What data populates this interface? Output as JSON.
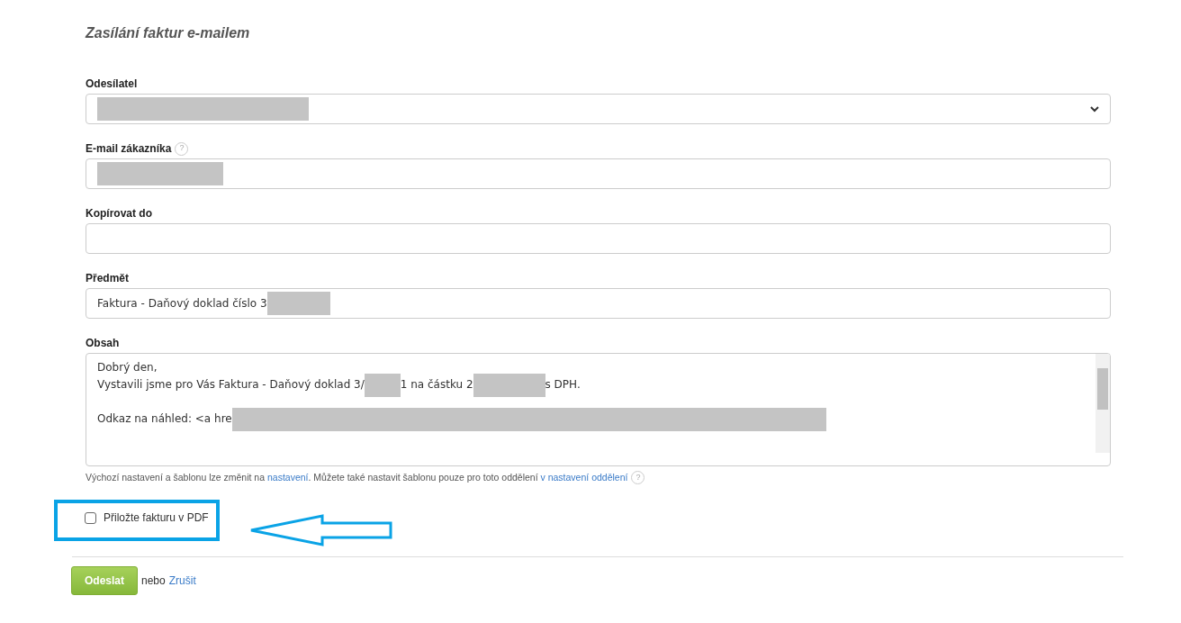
{
  "title": "Zasílání faktur e-mailem",
  "fields": [
    {
      "kind": "select",
      "label": "Odesílatel",
      "segments": [
        {
          "kind": "redacted"
        }
      ]
    },
    {
      "kind": "input",
      "label": "E-mail zákazníka",
      "help_icon": "?",
      "segments": [
        {
          "kind": "redacted"
        }
      ]
    },
    {
      "kind": "input",
      "label": "Kopírovat do"
    },
    {
      "kind": "input",
      "label": "Předmět",
      "segments": [
        {
          "kind": "text",
          "text": "Faktura - Daňový doklad číslo 3"
        },
        {
          "kind": "redacted"
        }
      ]
    },
    {
      "kind": "textarea",
      "label": "Obsah",
      "paragraphs": [
        [
          [
            {
              "kind": "text",
              "text": "Dobrý den,"
            }
          ],
          [
            {
              "kind": "text",
              "text": "Vystavili jsme pro Vás Faktura - Daňový doklad 3/"
            },
            {
              "kind": "redacted"
            },
            {
              "kind": "text",
              "text": "1 na částku 2"
            },
            {
              "kind": "redacted"
            },
            {
              "kind": "text",
              "text": "s DPH."
            }
          ]
        ],
        [
          [
            {
              "kind": "text",
              "text": "Odkaz na náhled: <a hre"
            },
            {
              "kind": "redacted"
            }
          ]
        ]
      ]
    }
  ],
  "note": {
    "text": "Výchozí nastavení a šablonu lze změnit na",
    "link1": "nastavení",
    "text2": ". Můžete také nastavit šablonu pouze pro toto oddělení",
    "link2": "v nastavení oddělení",
    "help_icon": "?"
  },
  "attach_pdf": {
    "label": "Přiložte fakturu v PDF",
    "checked": false
  },
  "submit": "Odeslat",
  "or": "nebo",
  "cancel": "Zrušit"
}
